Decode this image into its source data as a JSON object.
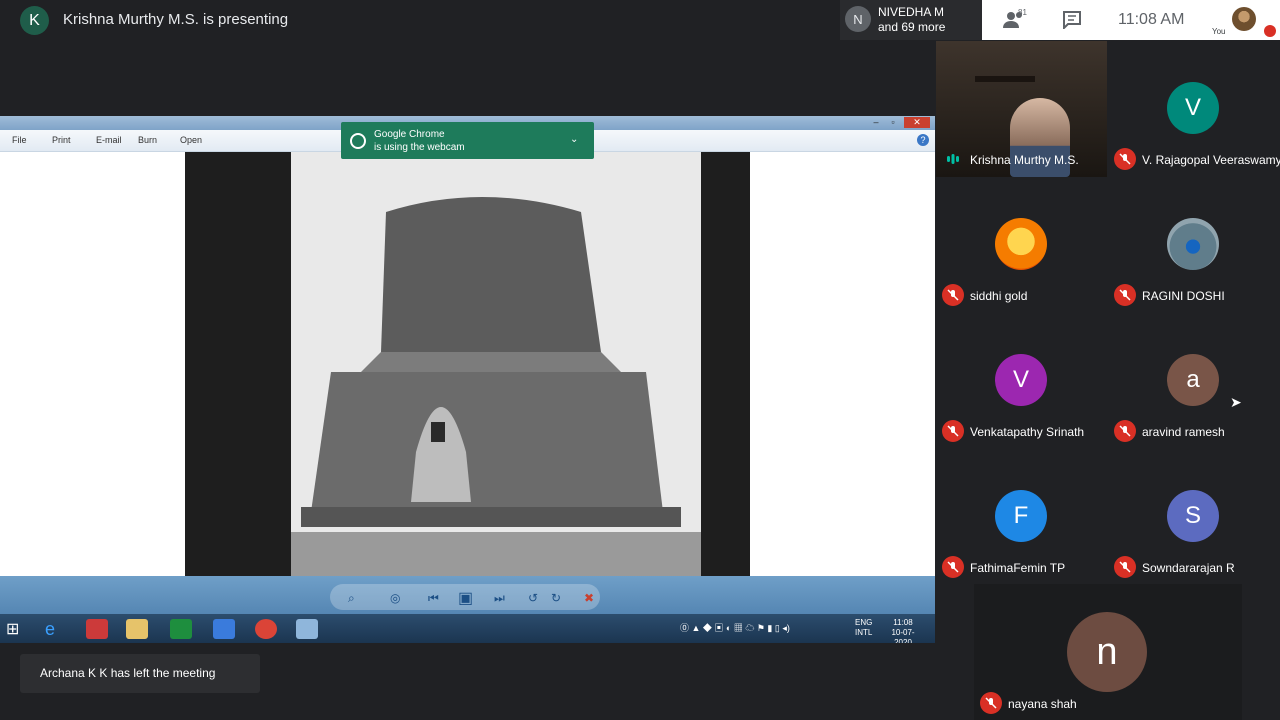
{
  "header": {
    "presenter_initial": "K",
    "presenting_text": "Krishna Murthy M.S. is presenting",
    "next_participant_initial": "N",
    "next_participant_line1": "NIVEDHA M",
    "next_participant_line2": "and 69 more",
    "people_count": "81",
    "clock": "11:08 AM",
    "you_label": "You"
  },
  "viewer": {
    "menu": [
      "File",
      "Print",
      "E-mail",
      "Burn",
      "Open"
    ],
    "help": "?"
  },
  "chrome_notice": {
    "line1": "Google Chrome",
    "line2": "is using the webcam"
  },
  "taskbar": {
    "lang_line1": "ENG",
    "lang_line2": "INTL",
    "time": "11:08",
    "date": "10-07-2020"
  },
  "toast": {
    "text": "Archana K K has left the meeting"
  },
  "participants": [
    {
      "name": "Krishna Murthy M.S.",
      "type": "video"
    },
    {
      "name": "V. Rajagopal Veeraswamy",
      "initial": "V",
      "color": "#00897b"
    },
    {
      "name": "siddhi gold",
      "initial": "",
      "color": "#f9a825"
    },
    {
      "name": "RAGINI DOSHI",
      "initial": "",
      "color": "#607d8b"
    },
    {
      "name": "Venkatapathy Srinath",
      "initial": "V",
      "color": "#9c27b0"
    },
    {
      "name": "aravind ramesh",
      "initial": "a",
      "color": "#795548"
    },
    {
      "name": "FathimaFemin TP",
      "initial": "F",
      "color": "#1e88e5"
    },
    {
      "name": "Sowndararajan R",
      "initial": "S",
      "color": "#5c6bc0"
    },
    {
      "name": "nayana shah",
      "initial": "n",
      "color": "#6d4c41"
    }
  ]
}
